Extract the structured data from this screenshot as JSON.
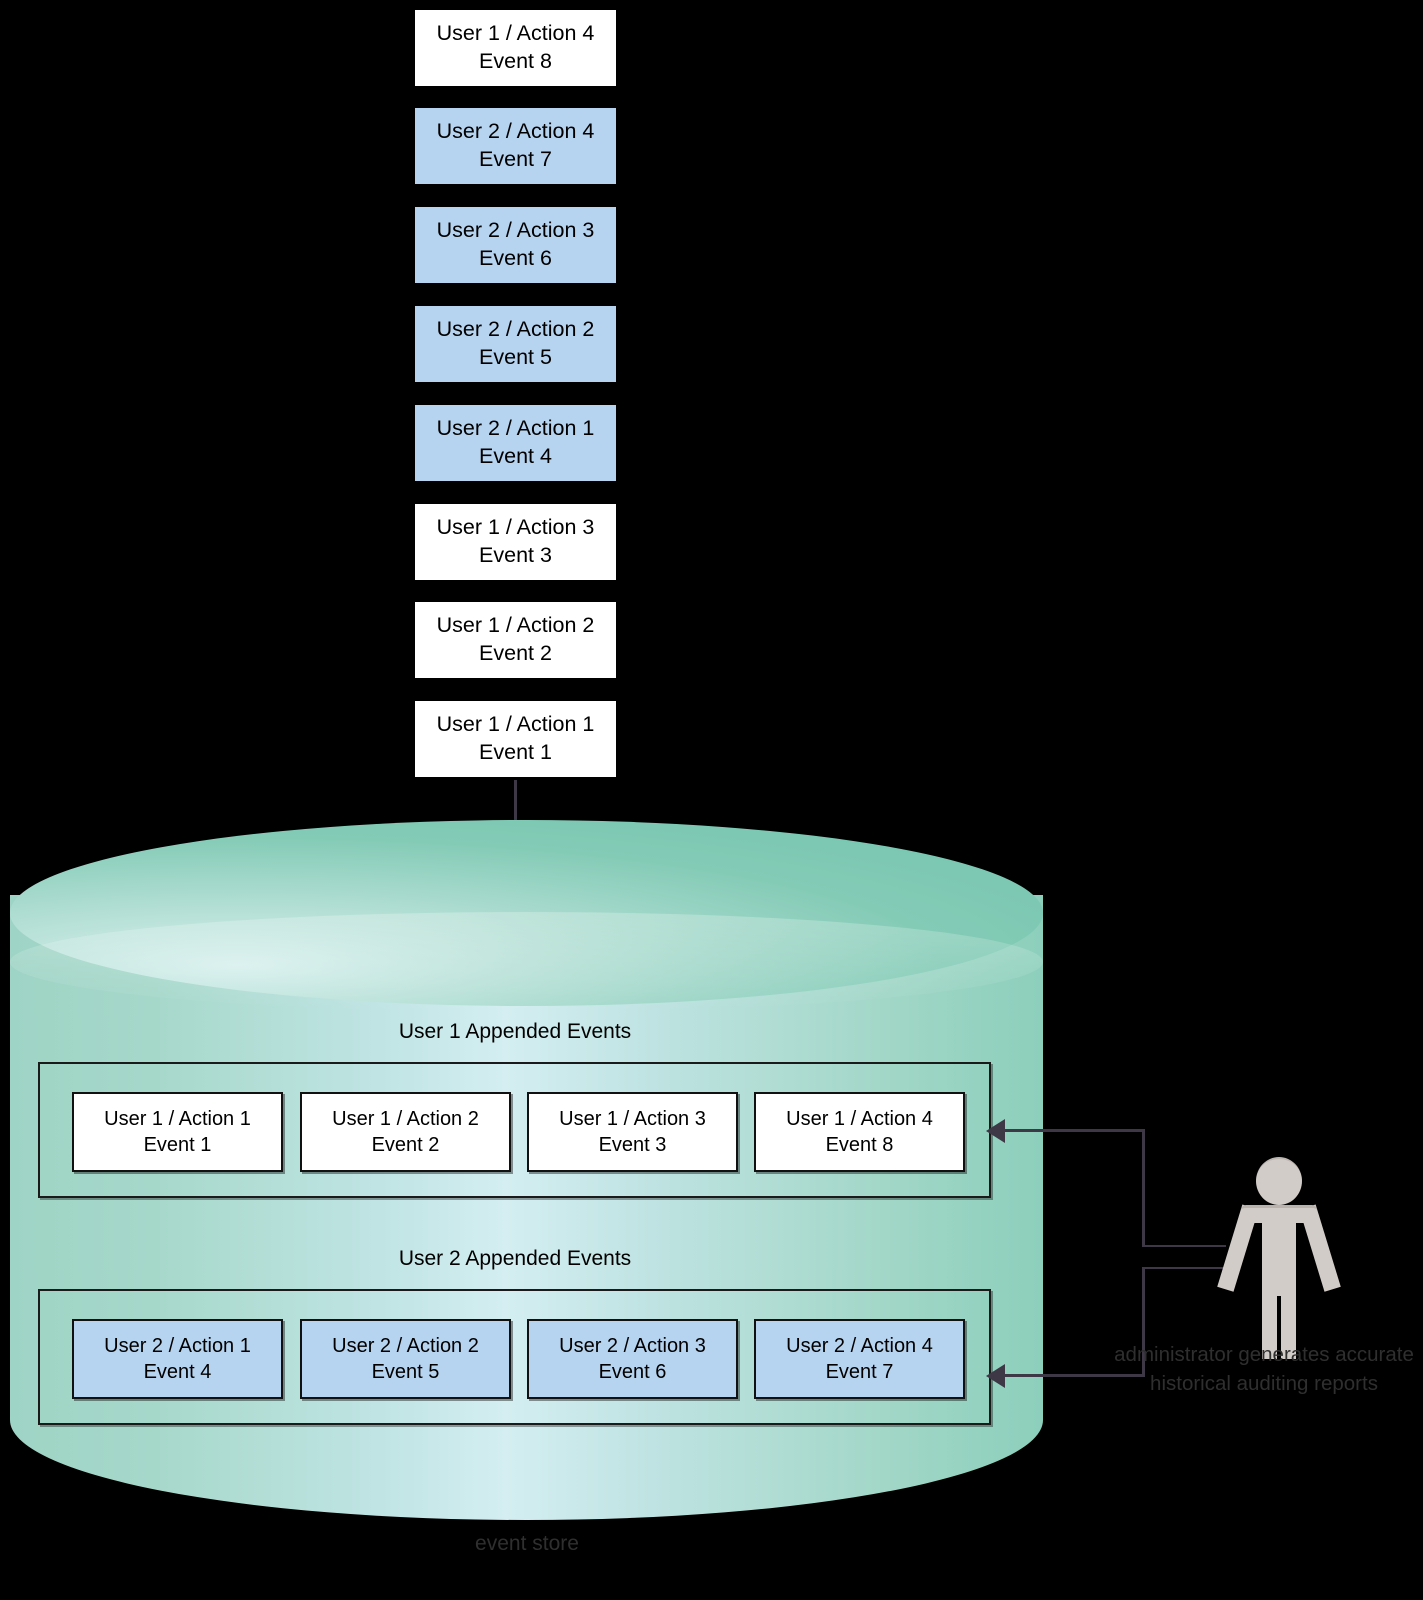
{
  "diagram": {
    "store_caption": "event store",
    "actor_caption": "administrator generates accurate historical auditing reports",
    "actor_icon": "person-icon"
  },
  "event_stack": {
    "items": [
      {
        "title": "User 1 / Action 4",
        "event": "Event 8",
        "user": "user1",
        "color": "#ffffff"
      },
      {
        "title": "User 2 / Action 4",
        "event": "Event 7",
        "user": "user2",
        "color": "#b6d4f0"
      },
      {
        "title": "User 2 / Action 3",
        "event": "Event 6",
        "user": "user2",
        "color": "#b6d4f0"
      },
      {
        "title": "User 2 / Action 2",
        "event": "Event 5",
        "user": "user2",
        "color": "#b6d4f0"
      },
      {
        "title": "User 2 / Action 1",
        "event": "Event 4",
        "user": "user2",
        "color": "#b6d4f0"
      },
      {
        "title": "User 1 / Action 3",
        "event": "Event 3",
        "user": "user1",
        "color": "#ffffff"
      },
      {
        "title": "User 1 / Action 2",
        "event": "Event 2",
        "user": "user1",
        "color": "#ffffff"
      },
      {
        "title": "User 1 / Action 1",
        "event": "Event 1",
        "user": "user1",
        "color": "#ffffff"
      }
    ]
  },
  "groups": [
    {
      "label": "User 1 Appended Events",
      "cards": [
        {
          "title": "User 1 / Action 1",
          "event": "Event 1"
        },
        {
          "title": "User 1 / Action 2",
          "event": "Event 2"
        },
        {
          "title": "User 1 / Action 3",
          "event": "Event 3"
        },
        {
          "title": "User 1 / Action 4",
          "event": "Event 8"
        }
      ]
    },
    {
      "label": "User 2 Appended Events",
      "cards": [
        {
          "title": "User 2 / Action 1",
          "event": "Event 4"
        },
        {
          "title": "User 2 / Action 2",
          "event": "Event 5"
        },
        {
          "title": "User 2 / Action 3",
          "event": "Event 6"
        },
        {
          "title": "User 2 / Action 4",
          "event": "Event 7"
        }
      ]
    }
  ],
  "colors": {
    "background": "#000000",
    "user1_fill": "#ffffff",
    "user2_fill": "#b6d4f0",
    "cylinder_green": "#8ccfbb",
    "cylinder_cyan": "#d4eef1",
    "connector": "#3d3746",
    "actor_fill": "#d2ccc8",
    "caption_text": "#2f2f2f"
  }
}
